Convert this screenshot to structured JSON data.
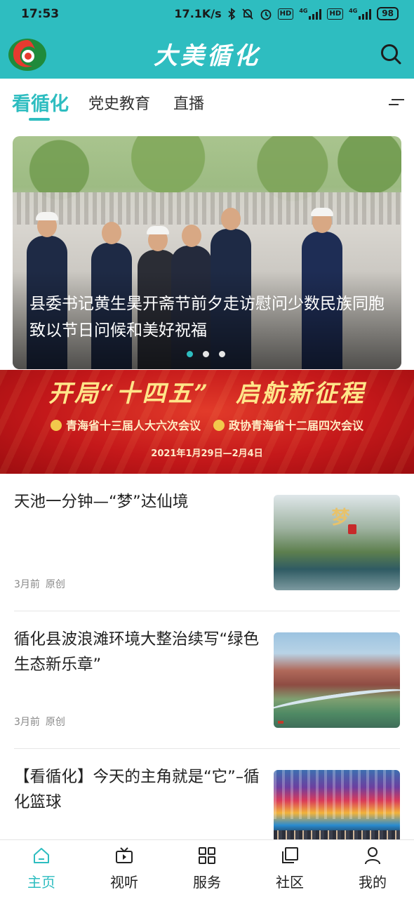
{
  "status_bar": {
    "time": "17:53",
    "network_speed": "17.1K/s",
    "battery": "98",
    "hd1": "HD",
    "hd2": "HD",
    "net1": "4G",
    "net2": "4G"
  },
  "header": {
    "app_title": "大美循化",
    "logo_icon": "app-logo",
    "search_icon": "search-icon",
    "background_color": "#2ebdc0"
  },
  "tabs": [
    {
      "label": "看循化",
      "active": true
    },
    {
      "label": "党史教育",
      "active": false
    },
    {
      "label": "直播",
      "active": false
    }
  ],
  "hero": {
    "caption": "县委书记黄生昊开斋节前夕走访慰问少数民族同胞　致以节日问候和美好祝福",
    "slide_count": 3,
    "active_slide": 1
  },
  "banner": {
    "title": "开局“十四五”　启航新征程",
    "sub_left": "青海省十三届人大六次会议",
    "sub_right": "政协青海省十二届四次会议",
    "date": "2021年1月29日—2月4日"
  },
  "news": [
    {
      "title": "天池一分钟—“梦”达仙境",
      "time": "3月前",
      "tag": "原创",
      "thumb_text": "梦"
    },
    {
      "title": "循化县波浪滩环境大整治续写“绿色生态新乐章”",
      "time": "3月前",
      "tag": "原创"
    },
    {
      "title": "【看循化】今天的主角就是“它”–循化篮球",
      "time": "",
      "tag": ""
    }
  ],
  "bottom_nav": [
    {
      "label": "主页",
      "icon": "home-icon",
      "active": true
    },
    {
      "label": "视听",
      "icon": "video-icon",
      "active": false
    },
    {
      "label": "服务",
      "icon": "grid-icon",
      "active": false
    },
    {
      "label": "社区",
      "icon": "community-icon",
      "active": false
    },
    {
      "label": "我的",
      "icon": "profile-icon",
      "active": false
    }
  ],
  "accent_color": "#2ebdc0"
}
